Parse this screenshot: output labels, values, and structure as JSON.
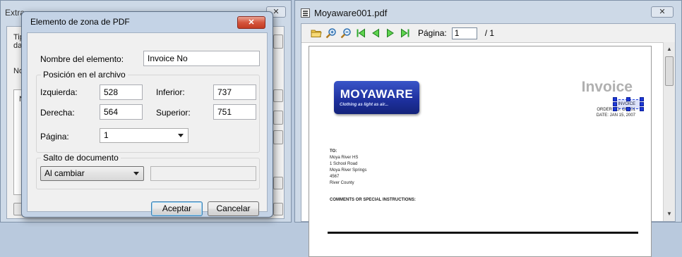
{
  "background_window": {
    "title": "Extra",
    "close_label": "✕",
    "fragments": {
      "line1": "Tip",
      "line2": "da",
      "line3": "No",
      "line4": "N"
    }
  },
  "pdf_window": {
    "title": "Moyaware001.pdf",
    "close_label": "✕",
    "toolbar": {
      "icons": [
        "open-folder-icon",
        "zoom-in-icon",
        "zoom-out-icon",
        "first-page-icon",
        "prev-page-icon",
        "next-page-icon",
        "last-page-icon"
      ],
      "page_label": "Página:",
      "page_value": "1",
      "page_total": "/ 1"
    },
    "invoice": {
      "logo_name": "MOYAWARE",
      "logo_tagline": "Clothing as light as air...",
      "title": "Invoice",
      "meta": [
        "INVOICE",
        "ORDER NO: OR001",
        "DATE: JAN 15, 2007"
      ],
      "to_heading": "TO:",
      "to_lines": [
        "Moya River  HS",
        "1 School Road",
        "Moya River Springs",
        " 4567",
        " River County"
      ],
      "comments": "COMMENTS OR SPECIAL INSTRUCTIONS:"
    }
  },
  "dialog": {
    "title": "Elemento de zona de PDF",
    "close_label": "✕",
    "element_name_label": "Nombre del elemento:",
    "element_name_value": "Invoice No",
    "position_group": "Posición en el archivo",
    "left_label": "Izquierda:",
    "left_value": "528",
    "bottom_label": "Inferior:",
    "bottom_value": "737",
    "right_label": "Derecha:",
    "right_value": "564",
    "top_label": "Superior:",
    "top_value": "751",
    "page_label": "Página:",
    "page_value": "1",
    "doc_break_group": "Salto de documento",
    "doc_break_value": "Al cambiar",
    "ok_label": "Aceptar",
    "cancel_label": "Cancelar"
  }
}
